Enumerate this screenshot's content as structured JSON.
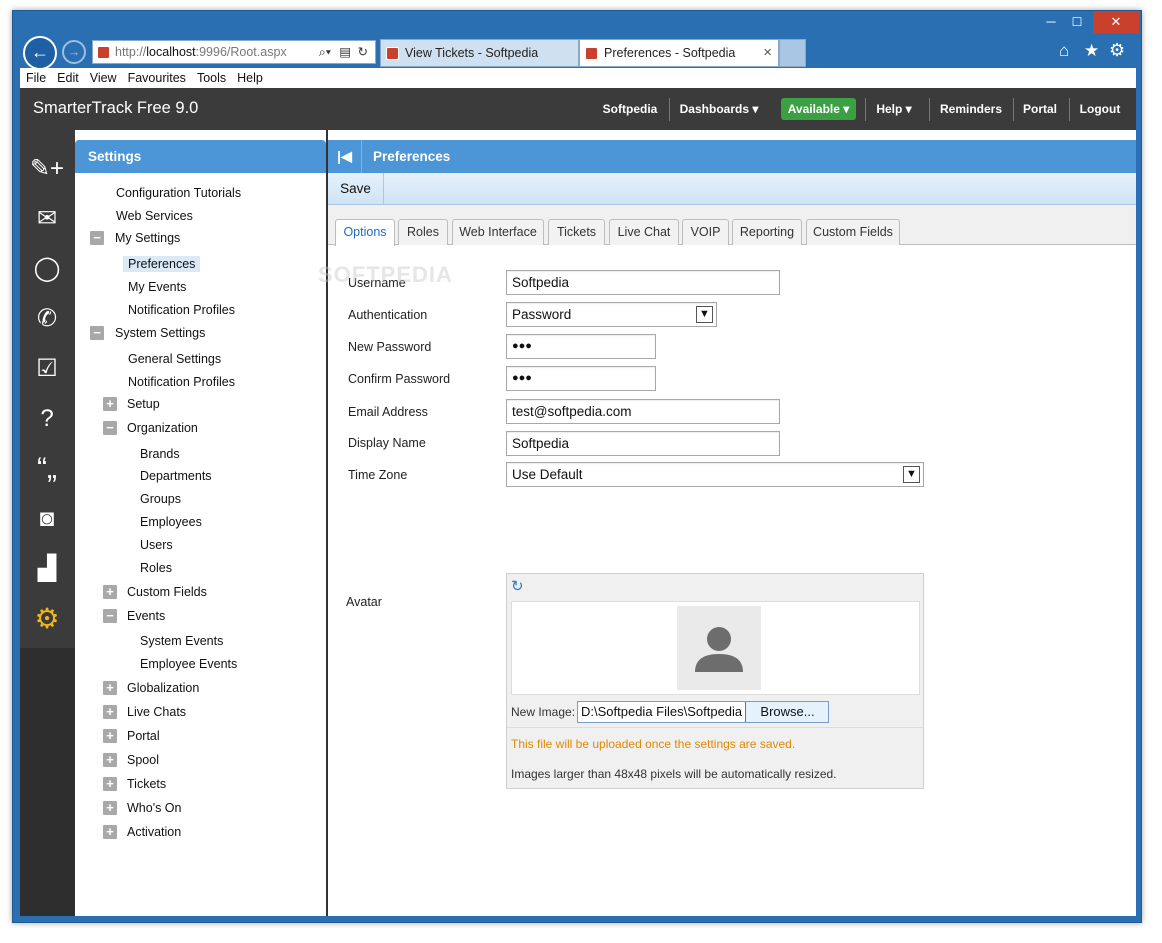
{
  "browser": {
    "window_controls": {
      "minimize": "─",
      "maximize": "☐",
      "close": "✕"
    },
    "address": {
      "prefix": "http://",
      "host": "localhost",
      "rest": ":9996/Root.aspx"
    },
    "tabs": [
      {
        "label": "View Tickets - Softpedia"
      },
      {
        "label": "Preferences - Softpedia"
      }
    ],
    "tab_close": "×",
    "menu": [
      "File",
      "Edit",
      "View",
      "Favourites",
      "Tools",
      "Help"
    ]
  },
  "app": {
    "brand": "SmarterTrack Free 9.0",
    "topnav": {
      "softpedia": "Softpedia",
      "dashboards": "Dashboards ▾",
      "available": "Available ▾",
      "help": "Help ▾",
      "reminders": "Reminders",
      "portal": "Portal",
      "logout": "Logout"
    },
    "accent_color": "#4c95d6",
    "available_color": "#3aa041"
  },
  "settings": {
    "title": "Settings",
    "tree": {
      "config_tutorials": "Configuration Tutorials",
      "web_services": "Web Services",
      "my_settings": "My Settings",
      "preferences": "Preferences",
      "my_events": "My Events",
      "notification_profiles": "Notification Profiles",
      "system_settings": "System Settings",
      "general_settings": "General Settings",
      "sys_notification_profiles": "Notification Profiles",
      "setup": "Setup",
      "organization": "Organization",
      "brands": "Brands",
      "departments": "Departments",
      "groups": "Groups",
      "employees": "Employees",
      "users": "Users",
      "roles": "Roles",
      "custom_fields": "Custom Fields",
      "events": "Events",
      "system_events": "System Events",
      "employee_events": "Employee Events",
      "globalization": "Globalization",
      "live_chats": "Live Chats",
      "portal": "Portal",
      "spool": "Spool",
      "tickets": "Tickets",
      "whos_on": "Who's On",
      "activation": "Activation"
    }
  },
  "preferences": {
    "title": "Preferences",
    "save": "Save",
    "tabs": [
      "Options",
      "Roles",
      "Web Interface",
      "Tickets",
      "Live Chat",
      "VOIP",
      "Reporting",
      "Custom Fields"
    ],
    "fields": {
      "username_label": "Username",
      "username": "Softpedia",
      "auth_label": "Authentication",
      "auth": "Password",
      "new_password_label": "New Password",
      "new_password": "●●●",
      "confirm_password_label": "Confirm Password",
      "confirm_password": "●●●",
      "email_label": "Email Address",
      "email": "test@softpedia.com",
      "display_name_label": "Display Name",
      "display_name": "Softpedia",
      "timezone_label": "Time Zone",
      "timezone": "Use Default",
      "avatar_label": "Avatar"
    },
    "avatar": {
      "new_image_label": "New Image:",
      "file_path": "D:\\Softpedia Files\\Softpedia",
      "browse": "Browse...",
      "note_upload": "This file will be uploaded once the settings are saved.",
      "note_resize": "Images larger than 48x48 pixels will be automatically resized."
    },
    "watermark": "SOFTPEDIA"
  }
}
